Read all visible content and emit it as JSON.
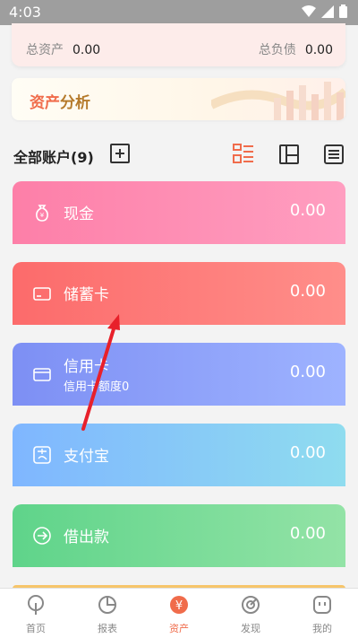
{
  "status_bar": {
    "time": "4:03"
  },
  "summary": {
    "total_assets_label": "总资产",
    "total_assets_value": "0.00",
    "total_liabilities_label": "总负债",
    "total_liabilities_value": "0.00"
  },
  "analysis": {
    "title_part1": "资产",
    "title_part2": "分析"
  },
  "accounts_header": {
    "title": "全部账户(9)"
  },
  "accounts": [
    {
      "name": "现金",
      "amount": "0.00",
      "icon": "money-bag-icon",
      "color_from": "#fd7fa8",
      "color_to": "#ff9ec0"
    },
    {
      "name": "储蓄卡",
      "amount": "0.00",
      "icon": "card-icon",
      "color_from": "#fc6b6b",
      "color_to": "#ff8e8a"
    },
    {
      "name": "信用卡",
      "sub": "信用卡额度0",
      "amount": "0.00",
      "icon": "credit-card-icon",
      "color_from": "#7d8ff4",
      "color_to": "#9eb3ff"
    },
    {
      "name": "支付宝",
      "amount": "0.00",
      "icon": "alipay-icon",
      "color_from": "#7fb6ff",
      "color_to": "#8fdcef"
    },
    {
      "name": "借出款",
      "amount": "0.00",
      "icon": "lend-icon",
      "color_from": "#5fd48a",
      "color_to": "#93e3a6"
    }
  ],
  "tabs": [
    {
      "label": "首页",
      "icon": "home-icon"
    },
    {
      "label": "报表",
      "icon": "report-icon"
    },
    {
      "label": "资产",
      "icon": "asset-icon",
      "active": true
    },
    {
      "label": "发现",
      "icon": "discover-icon"
    },
    {
      "label": "我的",
      "icon": "profile-icon"
    }
  ],
  "colors": {
    "accent": "#f06c4b",
    "tab_inactive": "#888888"
  }
}
